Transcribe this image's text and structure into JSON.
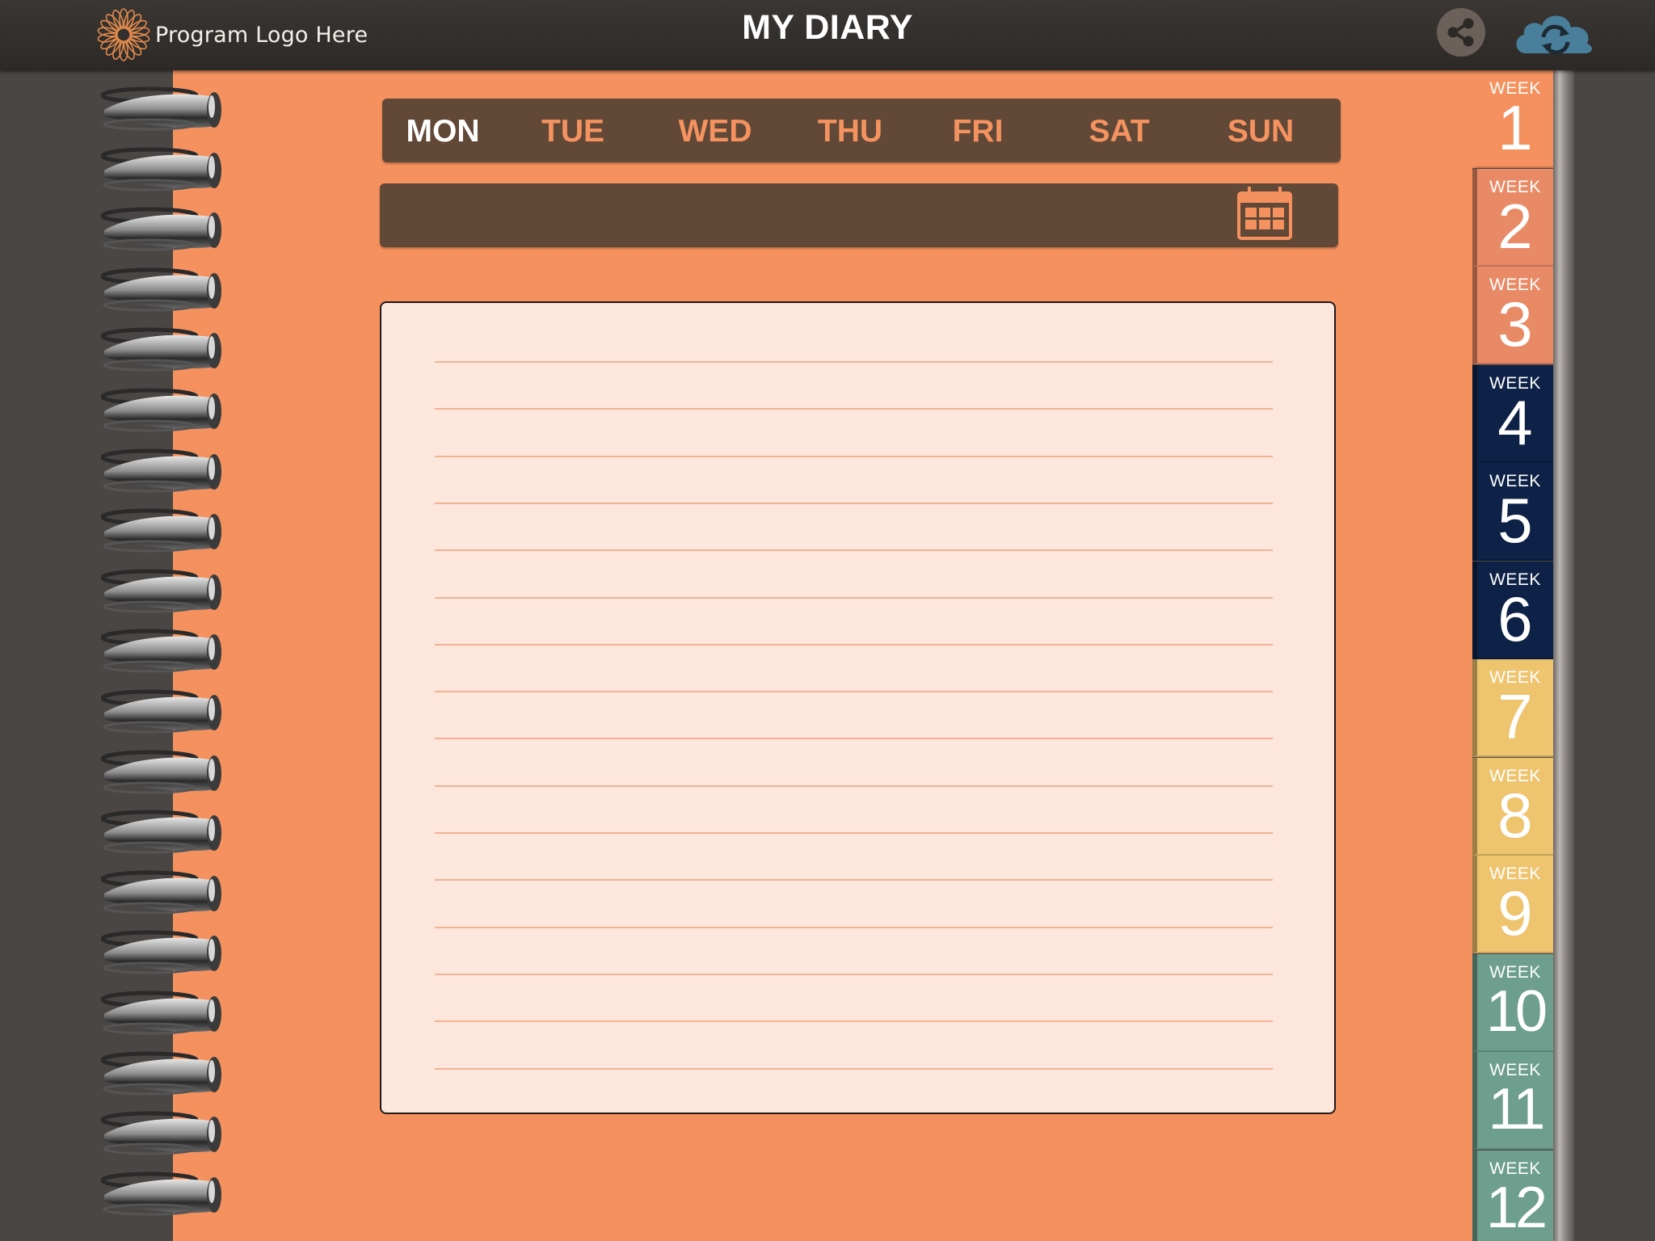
{
  "header": {
    "logo_text": "Program Logo Here",
    "title": "MY DIARY",
    "share_icon": "share-icon",
    "sync_icon": "cloud-sync-icon"
  },
  "days": [
    {
      "label": "MON",
      "active": true
    },
    {
      "label": "TUE",
      "active": false
    },
    {
      "label": "WED",
      "active": false
    },
    {
      "label": "THU",
      "active": false
    },
    {
      "label": "FRI",
      "active": false
    },
    {
      "label": "SAT",
      "active": false
    },
    {
      "label": "SUN",
      "active": false
    }
  ],
  "date_bar": {
    "value": "",
    "icon": "calendar-icon"
  },
  "entry": {
    "text": ""
  },
  "weeks": [
    {
      "label": "WEEK",
      "number": "1",
      "color": "#f5915e",
      "active": true
    },
    {
      "label": "WEEK",
      "number": "2",
      "color": "#e98a66",
      "active": false
    },
    {
      "label": "WEEK",
      "number": "3",
      "color": "#e98a66",
      "active": false
    },
    {
      "label": "WEEK",
      "number": "4",
      "color": "#0e2146",
      "active": false
    },
    {
      "label": "WEEK",
      "number": "5",
      "color": "#0e2146",
      "active": false
    },
    {
      "label": "WEEK",
      "number": "6",
      "color": "#0e2146",
      "active": false
    },
    {
      "label": "WEEK",
      "number": "7",
      "color": "#eec46f",
      "active": false
    },
    {
      "label": "WEEK",
      "number": "8",
      "color": "#eec46f",
      "active": false
    },
    {
      "label": "WEEK",
      "number": "9",
      "color": "#eec46f",
      "active": false
    },
    {
      "label": "WEEK",
      "number": "10",
      "color": "#6d9e8e",
      "active": false
    },
    {
      "label": "WEEK",
      "number": "11",
      "color": "#6d9e8e",
      "active": false
    },
    {
      "label": "WEEK",
      "number": "12",
      "color": "#6d9e8e",
      "active": false
    }
  ],
  "colors": {
    "page": "#f5915e",
    "bar": "#624837",
    "paper": "#fde6dc",
    "rule": "#f1b294",
    "header": "#2f2b29"
  }
}
